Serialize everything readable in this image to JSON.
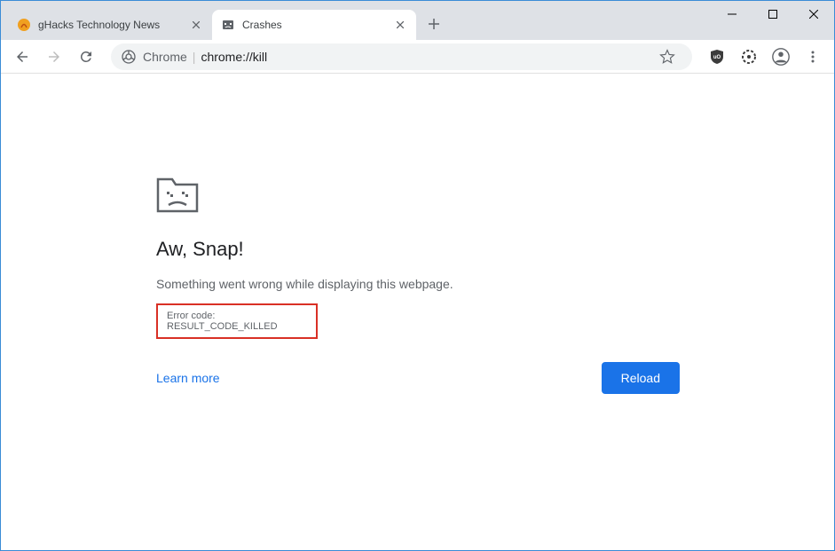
{
  "tabs": [
    {
      "title": "gHacks Technology News",
      "active": false
    },
    {
      "title": "Crashes",
      "active": true
    }
  ],
  "omnibox": {
    "scheme_label": "Chrome",
    "url": "chrome://kill"
  },
  "error": {
    "title": "Aw, Snap!",
    "message": "Something went wrong while displaying this webpage.",
    "code": "Error code: RESULT_CODE_KILLED",
    "learn_more": "Learn more",
    "reload": "Reload"
  }
}
